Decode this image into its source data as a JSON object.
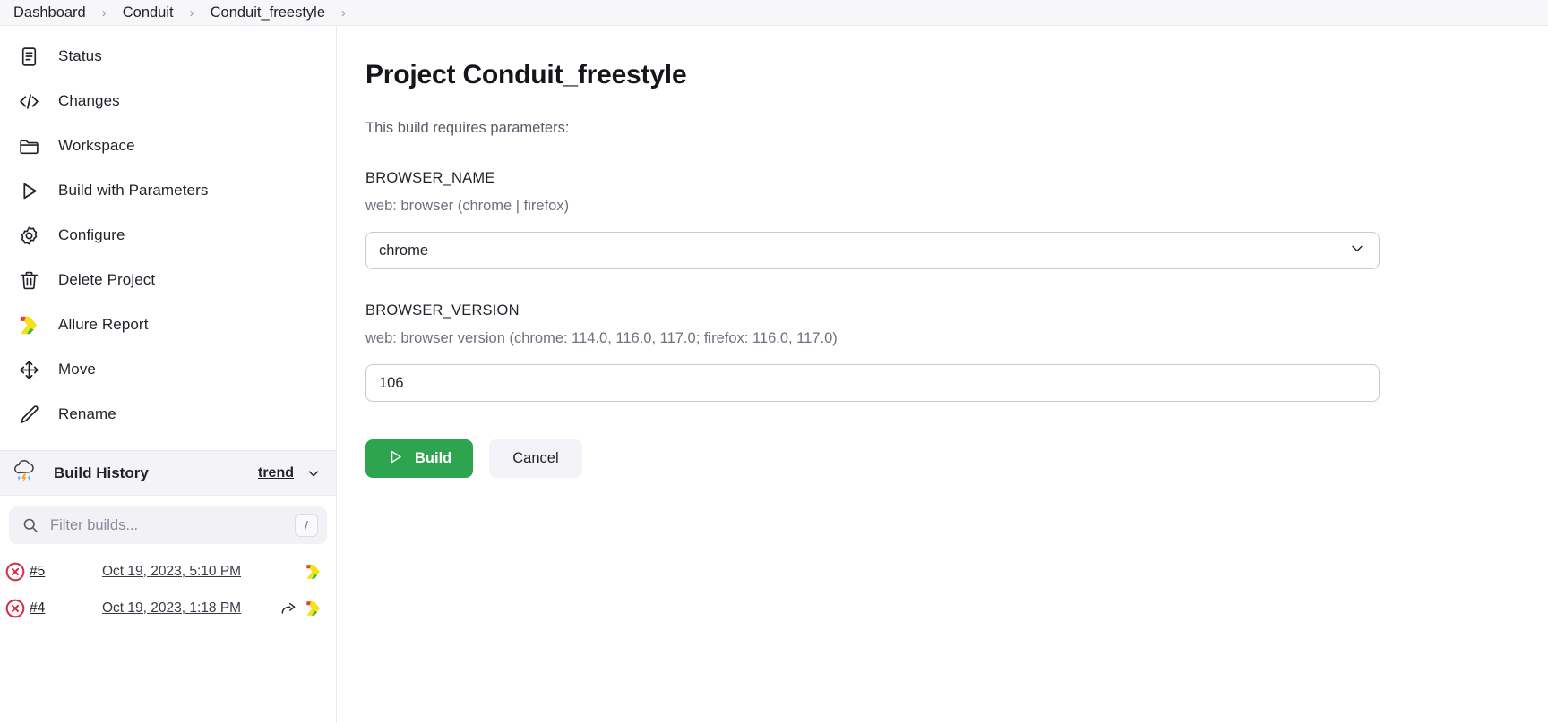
{
  "breadcrumb": {
    "items": [
      {
        "label": "Dashboard"
      },
      {
        "label": "Conduit"
      },
      {
        "label": "Conduit_freestyle"
      }
    ],
    "separator": "›"
  },
  "sidebar": {
    "items": [
      {
        "label": "Status",
        "icon": "document-icon"
      },
      {
        "label": "Changes",
        "icon": "code-icon"
      },
      {
        "label": "Workspace",
        "icon": "folder-icon"
      },
      {
        "label": "Build with Parameters",
        "icon": "play-icon"
      },
      {
        "label": "Configure",
        "icon": "gear-icon"
      },
      {
        "label": "Delete Project",
        "icon": "trash-icon"
      },
      {
        "label": "Allure Report",
        "icon": "allure-logo-icon"
      },
      {
        "label": "Move",
        "icon": "move-icon"
      },
      {
        "label": "Rename",
        "icon": "pencil-icon"
      }
    ],
    "build_history": {
      "title": "Build History",
      "icon": "cloud-storm-icon",
      "trend_label": "trend",
      "chevron_icon": "chevron-down-icon",
      "filter_placeholder": "Filter builds...",
      "filter_value": "",
      "filter_shortcut": "/",
      "search_icon": "search-icon",
      "builds": [
        {
          "number": "#5",
          "date": "Oct 19, 2023, 5:10 PM",
          "status": "failed",
          "status_icon": "circle-x-icon",
          "actions": [
            "allure-logo-icon"
          ]
        },
        {
          "number": "#4",
          "date": "Oct 19, 2023, 1:18 PM",
          "status": "failed",
          "status_icon": "circle-x-icon",
          "actions": [
            "share-arrow-icon",
            "allure-logo-icon"
          ]
        }
      ]
    }
  },
  "main": {
    "title": "Project Conduit_freestyle",
    "subtitle": "This build requires parameters:",
    "parameters": [
      {
        "name": "BROWSER_NAME",
        "description": "web: browser (chrome | firefox)",
        "type": "select",
        "value": "chrome",
        "options": [
          "chrome",
          "firefox"
        ],
        "chevron_icon": "chevron-down-icon"
      },
      {
        "name": "BROWSER_VERSION",
        "description": "web: browser version (chrome: 114.0, 116.0, 117.0; firefox: 116.0, 117.0)",
        "type": "text",
        "value": "106",
        "placeholder": ""
      }
    ],
    "buttons": {
      "build_label": "Build",
      "build_icon": "play-icon",
      "cancel_label": "Cancel"
    }
  },
  "colors": {
    "build_green": "#2fa44f",
    "failure_red": "#d4304a",
    "allure_yellow": "#f5e01a",
    "allure_red": "#e8412e",
    "allure_green": "#3ab54a",
    "sidebar_bg": "#f4f4f8"
  }
}
